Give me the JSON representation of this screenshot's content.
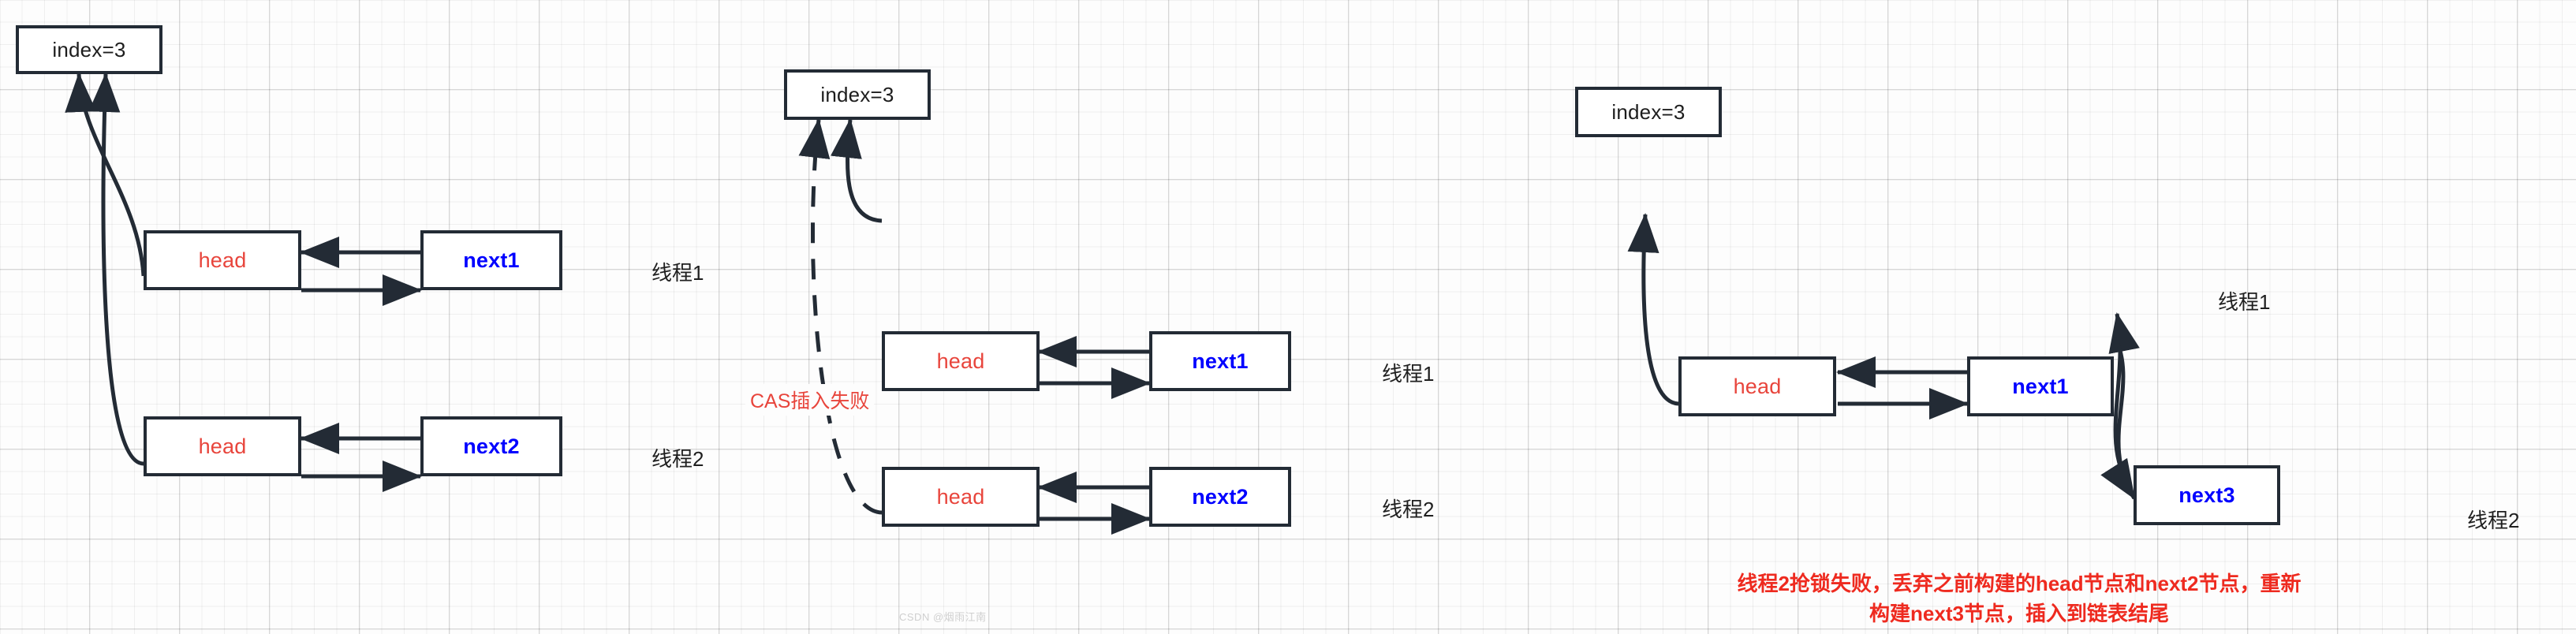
{
  "meta": {
    "watermark": "CSDN @烟雨江南",
    "bg_grid_color": "#eaeaea",
    "node_border_color": "#232b35",
    "head_text_color": "#e8453c",
    "next_text_color": "#0000ff",
    "note_color": "#ee2a1f",
    "edge_color": "#232b35"
  },
  "groups": [
    {
      "id": "group-1",
      "index_box": {
        "label": "index=3"
      },
      "rows": [
        {
          "left": "head",
          "right": "next1",
          "thread": "线程1"
        },
        {
          "left": "head",
          "right": "next2",
          "thread": "线程2"
        }
      ]
    },
    {
      "id": "group-2",
      "index_box": {
        "label": "index=3"
      },
      "annotation": "CAS插入失败",
      "rows": [
        {
          "left": "head",
          "right": "next1",
          "thread": "线程1"
        },
        {
          "left": "head",
          "right": "next2",
          "thread": "线程2"
        }
      ]
    },
    {
      "id": "group-3",
      "index_box": {
        "label": "index=3"
      },
      "rows": [
        {
          "left": "head",
          "right": "next1",
          "thread": "线程1"
        },
        {
          "tail": "next3",
          "thread": "线程2"
        }
      ]
    }
  ],
  "note": {
    "line1": "线程2抢锁失败，丢弃之前构建的head节点和next2节点，重新",
    "line2": "构建next3节点，插入到链表结尾"
  }
}
